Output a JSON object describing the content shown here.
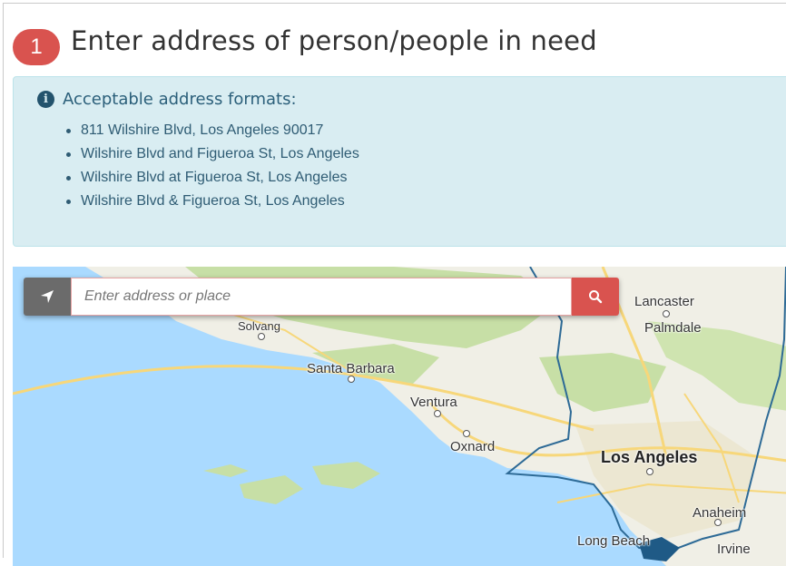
{
  "step": {
    "number": "1",
    "title": "Enter address of person/people in need"
  },
  "info": {
    "heading": "Acceptable address formats:",
    "formats": [
      "811 Wilshire Blvd, Los Angeles 90017",
      "Wilshire Blvd and Figueroa St, Los Angeles",
      "Wilshire Blvd at Figueroa St, Los Angeles",
      "Wilshire Blvd & Figueroa St, Los Angeles"
    ]
  },
  "search": {
    "placeholder": "Enter address or place"
  },
  "map": {
    "labels": {
      "lancaster": "Lancaster",
      "palmdale": "Palmdale",
      "solvang": "Solvang",
      "santa_barbara": "Santa Barbara",
      "ventura": "Ventura",
      "oxnard": "Oxnard",
      "los_angeles": "Los Angeles",
      "anaheim": "Anaheim",
      "long_beach": "Long Beach",
      "irvine": "Irvine"
    }
  },
  "colors": {
    "accent": "#d9534f",
    "info_bg": "#d9edf2",
    "locate_btn": "#6b6b6b"
  },
  "icons": {
    "info": "info-circle-icon",
    "locate": "location-arrow-icon",
    "search": "search-icon"
  }
}
